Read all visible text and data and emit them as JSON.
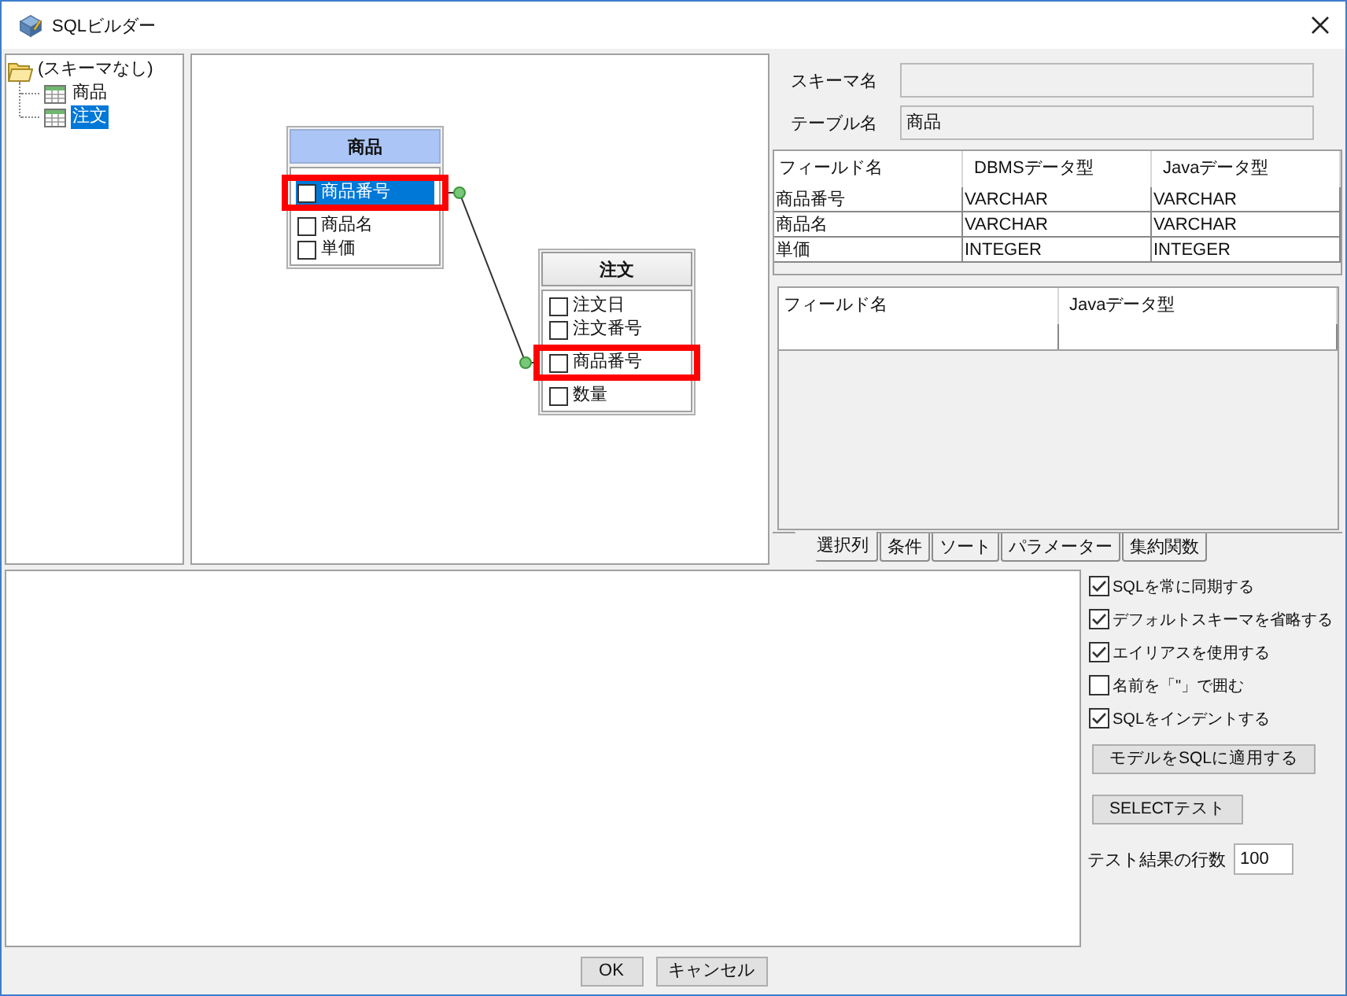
{
  "window": {
    "title": "SQLビルダー"
  },
  "schema_tree": [
    {
      "label": "(スキーマなし)",
      "expanded": true,
      "selected": false,
      "children": [
        {
          "label": "商品",
          "selected": false
        },
        {
          "label": "注文",
          "selected": true
        }
      ]
    }
  ],
  "diagram": {
    "tables": [
      {
        "name": "商品",
        "selected": true,
        "fields": [
          {
            "name": "商品番号",
            "checked": false,
            "selected": true,
            "highlighted": true
          },
          {
            "name": "商品名",
            "checked": false,
            "selected": false,
            "highlighted": false
          },
          {
            "name": "単価",
            "checked": false,
            "selected": false,
            "highlighted": false
          }
        ]
      },
      {
        "name": "注文",
        "selected": false,
        "fields": [
          {
            "name": "注文日",
            "checked": false,
            "selected": false,
            "highlighted": false
          },
          {
            "name": "注文番号",
            "checked": false,
            "selected": false,
            "highlighted": false
          },
          {
            "name": "商品番号",
            "checked": false,
            "selected": false,
            "highlighted": true
          },
          {
            "name": "数量",
            "checked": false,
            "selected": false,
            "highlighted": false
          }
        ]
      }
    ]
  },
  "table_info": {
    "fields": [
      {
        "label": "スキーマ名",
        "disabled": true
      },
      {
        "label": "テーブル名",
        "value": "商品",
        "disabled": true
      }
    ]
  },
  "column_table": {
    "columns": [
      "フィールド名",
      "DBMSデータ型",
      "Javaデータ型"
    ],
    "rows": [
      [
        "商品番号",
        "VARCHAR",
        "VARCHAR"
      ],
      [
        "商品名",
        "VARCHAR",
        "VARCHAR"
      ],
      [
        "単価",
        "INTEGER",
        "INTEGER"
      ]
    ]
  },
  "selection_table": {
    "columns": [
      "フィールド名",
      "Javaデータ型"
    ]
  },
  "tabs": [
    {
      "label": "選択列",
      "selected": true
    },
    {
      "label": "条件",
      "selected": false
    },
    {
      "label": "ソート",
      "selected": false
    },
    {
      "label": "パラメーター",
      "selected": false
    },
    {
      "label": "集約関数",
      "selected": false
    }
  ],
  "options": [
    {
      "label": "SQLを常に同期する",
      "checked": true
    },
    {
      "label": "デフォルトスキーマを省略する",
      "checked": true
    },
    {
      "label": "エイリアスを使用する",
      "checked": true
    },
    {
      "label": "名前を「\"」で囲む",
      "checked": false
    },
    {
      "label": "SQLをインデントする",
      "checked": true
    }
  ],
  "actions": [
    {
      "label": "モデルをSQLに適用する"
    },
    {
      "label": "SELECTテスト"
    }
  ],
  "row_limit": {
    "label": "テスト結果の行数",
    "value": "100"
  },
  "dialog_buttons": [
    {
      "label": "OK"
    },
    {
      "label": "キャンセル"
    }
  ]
}
